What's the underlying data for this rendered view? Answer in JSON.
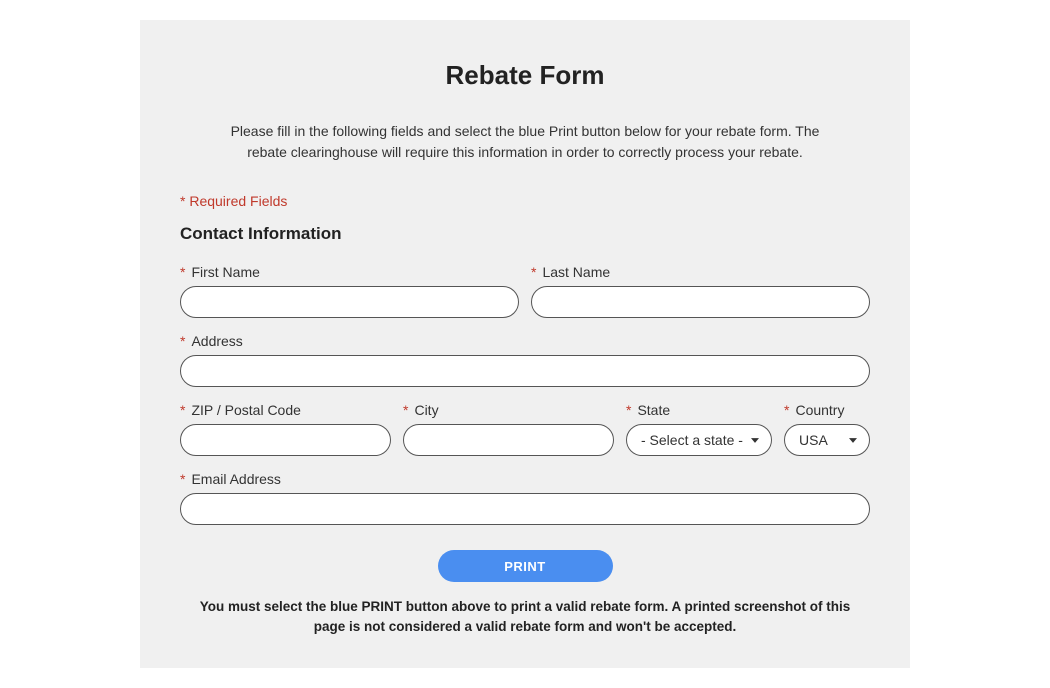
{
  "title": "Rebate Form",
  "description": "Please fill in the following fields and select the blue Print button below for your rebate form. The rebate clearinghouse will require this information in order to correctly process your rebate.",
  "required_legend": "* Required Fields",
  "section_heading": "Contact Information",
  "labels": {
    "first_name": "First Name",
    "last_name": "Last Name",
    "address": "Address",
    "zip": "ZIP / Postal Code",
    "city": "City",
    "state": "State",
    "country": "Country",
    "email": "Email Address"
  },
  "values": {
    "first_name": "",
    "last_name": "",
    "address": "",
    "zip": "",
    "city": "",
    "state_placeholder": "- Select a state -",
    "country": "USA",
    "email": ""
  },
  "print_button": "PRINT",
  "footer_note": "You must select the blue PRINT button above to print a valid rebate form. A printed screenshot of this page is not considered a valid rebate form and won't be accepted."
}
